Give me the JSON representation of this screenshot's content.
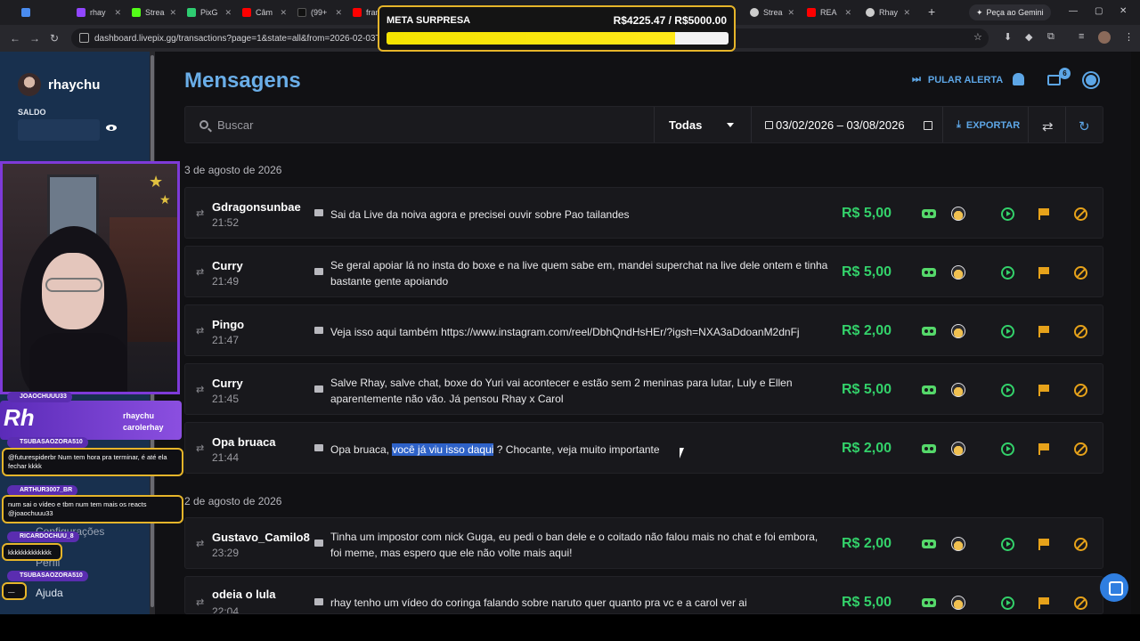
{
  "browser": {
    "tabs": [
      {
        "label": "",
        "color": "#4a8cf0"
      },
      {
        "label": "rhay",
        "color": "#9146ff"
      },
      {
        "label": "Strea",
        "color": "#53fc18"
      },
      {
        "label": "PixG",
        "color": "#2ecc71"
      },
      {
        "label": "Câm",
        "color": "#ff0000"
      },
      {
        "label": "(99+",
        "color": "#111111"
      },
      {
        "label": "fran",
        "color": "#ff0000"
      },
      {
        "label": "Strea",
        "color": "#cccccc"
      },
      {
        "label": "REA",
        "color": "#ff0000"
      },
      {
        "label": "Rhay",
        "color": "#cccccc"
      }
    ],
    "gemini_label": "Peça ao Gemini",
    "url": "dashboard.livepix.gg/transactions?page=1&state=all&from=2026-02-03T00%"
  },
  "goal": {
    "title": "META SURPRESA",
    "value_text": "R$4225.47 / R$5000.00",
    "progress": 0.845
  },
  "sidebar": {
    "username": "rhaychu",
    "saldo_label": "SALDO",
    "items": {
      "config": "Configurações",
      "perfil": "Perfil",
      "ajuda": "Ajuda"
    }
  },
  "overlay": {
    "banner_text": "Rh",
    "handles": [
      "rhaychu",
      "carolerhay"
    ],
    "chat": [
      {
        "user": "JOAOCHUUU33",
        "text": ""
      },
      {
        "user": "TSUBASAOZORA510",
        "text": "@futurespiderbr Num tem hora pra terminar, é até ela fechar kkkk"
      },
      {
        "user": "ARTHUR3007_BR",
        "text": "num sai o vídeo e tbm num tem mais os reacts @joaochuuu33"
      },
      {
        "user": "RICARDOCHUU_8",
        "text": "kkkkkkkkkkkkk"
      },
      {
        "user": "TSUBASAOZORA510",
        "text": "—"
      }
    ]
  },
  "page": {
    "title": "Mensagens",
    "pular_alerta": "PULAR ALERTA",
    "notification_count": "6",
    "search_placeholder": "Buscar",
    "filter_value": "Todas",
    "date_range": "03/02/2026 – 03/08/2026",
    "export_label": "EXPORTAR"
  },
  "groups": [
    {
      "date": "3 de agosto de 2026",
      "rows": [
        {
          "name": "Gdragonsunbae",
          "time": "21:52",
          "message": "Sai da Live da noiva agora e precisei ouvir sobre Pao tailandes",
          "amount": "R$ 5,00"
        },
        {
          "name": "Curry",
          "time": "21:49",
          "message": "Se geral apoiar lá no insta do boxe e na live quem sabe em, mandei superchat na live dele ontem e tinha bastante gente apoiando",
          "amount": "R$ 5,00"
        },
        {
          "name": "Pingo",
          "time": "21:47",
          "message": "Veja isso aqui também https://www.instagram.com/reel/DbhQndHsHEr/?igsh=NXA3aDdoanM2dnFj",
          "amount": "R$ 2,00"
        },
        {
          "name": "Curry",
          "time": "21:45",
          "message": "Salve Rhay, salve chat, boxe do Yuri vai acontecer e estão sem 2 meninas para lutar, Luly e Ellen aparentemente não vão. Já pensou Rhay x Carol",
          "amount": "R$ 5,00"
        },
        {
          "name": "Opa bruaca",
          "time": "21:44",
          "message_pre": "Opa bruaca, ",
          "message_hl": "você já viu isso daqui",
          "message_post": " ? Chocante, veja muito importante",
          "amount": "R$ 2,00"
        }
      ]
    },
    {
      "date": "2 de agosto de 2026",
      "rows": [
        {
          "name": "Gustavo_Camilo8",
          "time": "23:29",
          "message": "Tinha um impostor com nick Guga, eu pedi o ban dele e o coitado não falou mais no chat e foi embora, foi meme, mas espero que ele não volte mais aqui!",
          "amount": "R$ 2,00"
        },
        {
          "name": "odeia o lula",
          "time": "22:04",
          "message": "rhay tenho um vídeo do coringa falando sobre naruto quer quanto pra vc e a carol ver ai",
          "amount": "R$ 5,00"
        }
      ]
    }
  ]
}
